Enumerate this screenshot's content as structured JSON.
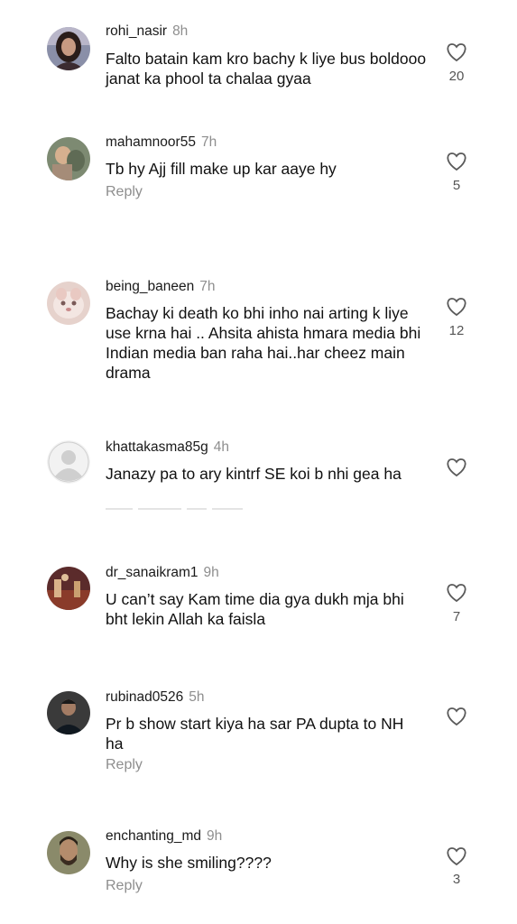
{
  "comments": [
    {
      "username": "rohi_nasir",
      "time": "8h",
      "text": "Falto batain kam kro bachy k liye bus boldooo janat ka phool ta chalaa gyaa",
      "reply": "",
      "likes": "20"
    },
    {
      "username": "mahamnoor55",
      "time": "7h",
      "text": "Tb hy Ajj fill make up kar aaye hy",
      "reply": "Reply",
      "likes": "5"
    },
    {
      "username": "being_baneen",
      "time": "7h",
      "text": "Bachay ki death ko bhi inho nai arting k liye use krna hai .. Ahsita ahista hmara media bhi Indian media ban raha hai..har cheez main drama",
      "reply": "",
      "likes": "12"
    },
    {
      "username": "khattakasma85g",
      "time": "4h",
      "text": "Janazy pa to ary kintrf SE koi b nhi gea ha",
      "reply": "",
      "likes": ""
    },
    {
      "username": "dr_sanaikram1",
      "time": "9h",
      "text": "U can’t say Kam time dia gya dukh mja bhi bht lekin Allah ka faisla",
      "reply": "",
      "likes": "7"
    },
    {
      "username": "rubinad0526",
      "time": "5h",
      "text": "Pr b show start kiya ha sar PA dupta to NH ha",
      "reply": "Reply",
      "likes": ""
    },
    {
      "username": "enchanting_md",
      "time": "9h",
      "text": "Why is she smiling????",
      "reply": "Reply",
      "likes": "3"
    }
  ],
  "icons": {
    "like": "heart-outline-icon",
    "avatar_default": "default-user-icon"
  },
  "colors": {
    "secondary_text": "#8e8e8e",
    "primary_text": "#111111",
    "background": "#ffffff"
  }
}
